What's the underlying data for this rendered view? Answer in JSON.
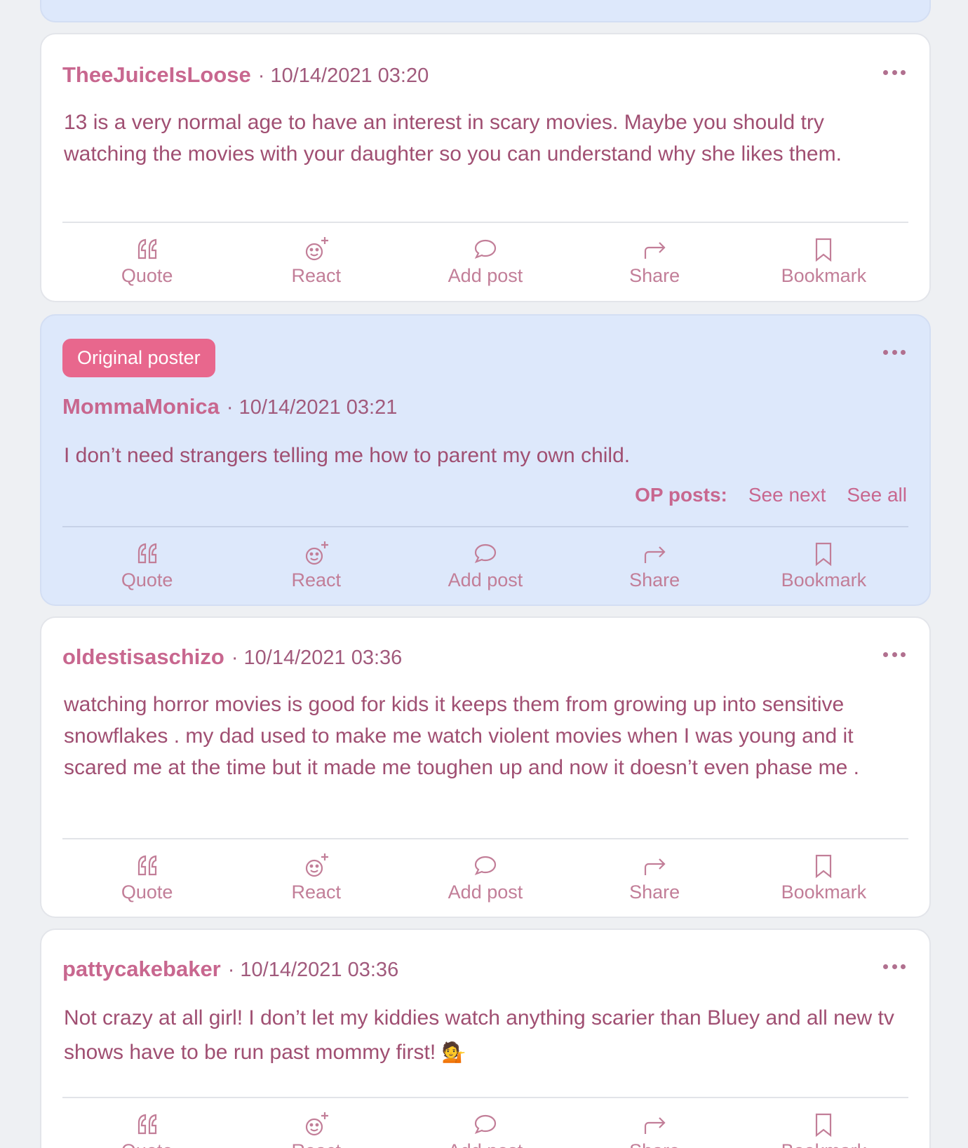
{
  "colors": {
    "accent": "#c8678f",
    "badge": "#e8678d",
    "op_background": "#dde8fb",
    "text": "#a04f72"
  },
  "action_labels": {
    "quote": "Quote",
    "react": "React",
    "add_post": "Add post",
    "share": "Share",
    "bookmark": "Bookmark"
  },
  "action_icons": {
    "quote": "quote-icon",
    "react": "react-icon",
    "add_post": "speech-bubble-icon",
    "share": "share-arrow-icon",
    "bookmark": "bookmark-icon"
  },
  "posts": [
    {
      "username": "TheeJuiceIsLoose",
      "separator": "·",
      "timestamp": "10/14/2021 03:20",
      "body": "13 is a very normal age to have an interest in scary movies. Maybe you should try watching the movies with your daughter so you can understand why she likes them."
    },
    {
      "badge": "Original poster",
      "username": "MommaMonica",
      "separator": "·",
      "timestamp": "10/14/2021 03:21",
      "body": "I don’t need strangers telling me how to parent my own child.",
      "op_posts_label": "OP posts:",
      "see_next": "See next",
      "see_all": "See all"
    },
    {
      "username": "oldestisaschizo",
      "separator": "·",
      "timestamp": "10/14/2021 03:36",
      "body": "watching horror movies is good for kids it keeps them from growing up into sensitive snowflakes . my dad used to make me watch violent movies when I was young and it scared me at the time but it made me toughen up and now it doesn’t even phase me ."
    },
    {
      "username": "pattycakebaker",
      "separator": "·",
      "timestamp": "10/14/2021 03:36",
      "body": "Not crazy at all girl! I don’t let my kiddies watch anything scarier than Bluey and all new tv shows have to be run past mommy first!",
      "emoji": "💁"
    }
  ]
}
